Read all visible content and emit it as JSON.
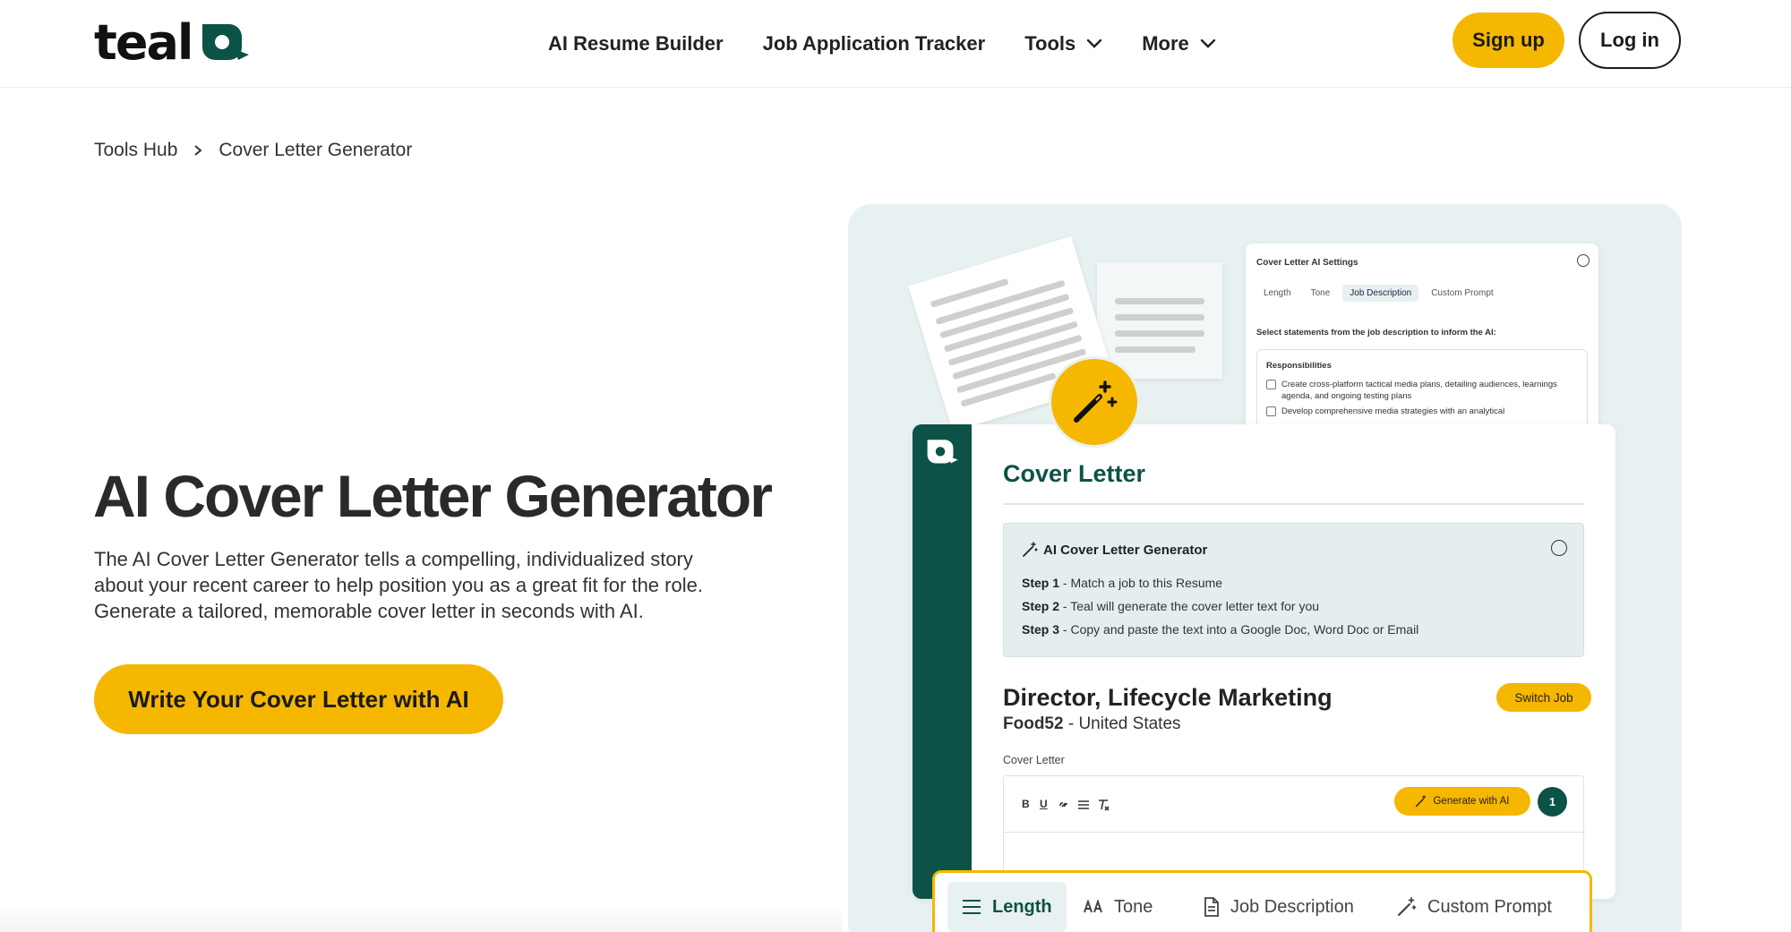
{
  "nav": {
    "logo_text": "teal",
    "links": [
      {
        "label": "AI Resume Builder"
      },
      {
        "label": "Job Application Tracker"
      },
      {
        "label": "Tools",
        "has_dropdown": true
      },
      {
        "label": "More",
        "has_dropdown": true
      }
    ],
    "signup_label": "Sign up",
    "login_label": "Log in"
  },
  "breadcrumb": {
    "items": [
      "Tools Hub",
      "Cover Letter Generator"
    ]
  },
  "hero": {
    "title": "AI Cover Letter Generator",
    "description": "The AI Cover Letter Generator tells a compelling, individualized story about your recent career to help position you as a great fit for the role. Generate a tailored, memorable cover letter in seconds with AI.",
    "cta_label": "Write Your Cover Letter with AI"
  },
  "illustration": {
    "settings_panel": {
      "title": "Cover Letter AI Settings",
      "tabs": [
        "Length",
        "Tone",
        "Job Description",
        "Custom Prompt"
      ],
      "active_tab": "Job Description",
      "question": "Select statements from the job description to inform the AI:",
      "section": "Responsibilities",
      "items": [
        "Create cross-platform tactical media plans, detailing audiences, learnings agenda, and ongoing testing plans",
        "Develop comprehensive media strategies with an analytical"
      ]
    },
    "card": {
      "title": "Cover Letter",
      "ai_box": {
        "heading": "AI Cover Letter Generator",
        "steps": [
          {
            "label": "Step 1",
            "text": " - Match a job to this Resume"
          },
          {
            "label": "Step 2",
            "text": " - Teal will generate the cover letter text for you"
          },
          {
            "label": "Step 3",
            "text": " - Copy and paste the text into a Google Doc, Word Doc or Email"
          }
        ]
      },
      "job_title": "Director, Lifecycle Marketing",
      "company": "Food52",
      "location": " - United States",
      "switch_label": "Switch Job",
      "editor_label": "Cover Letter",
      "format_buttons": [
        "B",
        "U",
        "link-icon",
        "list-icon",
        "clear-format-icon"
      ],
      "generate_label": "Generate with AI",
      "badge_count": "1"
    },
    "toolbar": {
      "items": [
        {
          "label": "Length",
          "icon": "menu-lines-icon",
          "active": true
        },
        {
          "label": "Tone",
          "icon": "tone-icon",
          "active": false
        },
        {
          "label": "Job Description",
          "icon": "document-icon",
          "active": false
        },
        {
          "label": "Custom Prompt",
          "icon": "magic-wand-icon",
          "active": false
        }
      ]
    }
  },
  "colors": {
    "brand_yellow": "#f6b700",
    "brand_teal": "#0c5247",
    "illustration_bg": "#e8f1f1"
  }
}
